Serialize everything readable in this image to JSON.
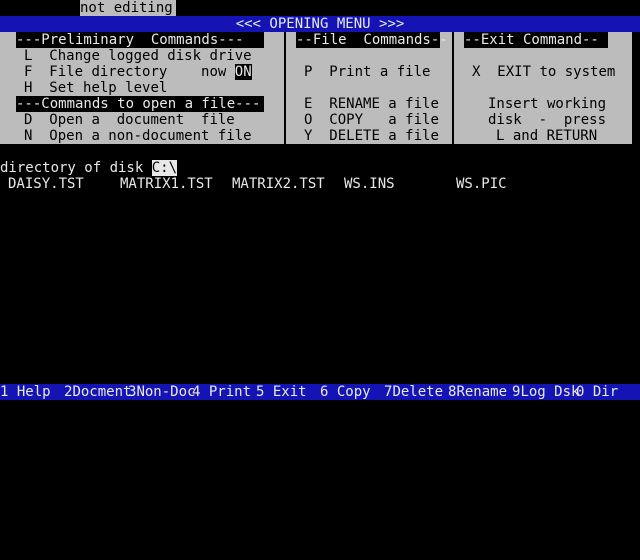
{
  "status": "not editing",
  "title": "<<< OPENING MENU >>>",
  "sections": {
    "preliminary": {
      "header": "---Preliminary  Commands---",
      "items": [
        {
          "key": "L",
          "label": "Change logged disk drive"
        },
        {
          "key": "F",
          "label": "File directory",
          "state_prefix": "now",
          "state": "ON"
        },
        {
          "key": "H",
          "label": "Set help level"
        }
      ]
    },
    "open_file": {
      "header": "---Commands to open a file---",
      "items": [
        {
          "key": "D",
          "label": "Open a  document  file"
        },
        {
          "key": "N",
          "label": "Open a non-document file"
        }
      ]
    },
    "file_commands": {
      "header": "--File  Commands--",
      "items": [
        {
          "key": "P",
          "label": "Print a file"
        },
        {
          "key": "E",
          "label": "RENAME a file"
        },
        {
          "key": "O",
          "label": "COPY   a file"
        },
        {
          "key": "Y",
          "label": "DELETE a file"
        }
      ]
    },
    "exit": {
      "header": "--Exit Command--",
      "items": [
        {
          "key": "X",
          "label": "EXIT to system"
        }
      ],
      "note": [
        "Insert working",
        "disk  -  press",
        "L and RETURN"
      ]
    }
  },
  "directory": {
    "label": "directory of disk",
    "drive": "C:\\",
    "files": [
      "DAISY.TST",
      "MATRIX1.TST",
      "MATRIX2.TST",
      "WS.INS",
      "WS.PIC"
    ]
  },
  "function_keys": [
    {
      "num": "1",
      "label": "Help"
    },
    {
      "num": "2",
      "label": "Docment"
    },
    {
      "num": "3",
      "label": "Non-Doc"
    },
    {
      "num": "4",
      "label": "Print"
    },
    {
      "num": "5",
      "label": "Exit"
    },
    {
      "num": "6",
      "label": "Copy"
    },
    {
      "num": "7",
      "label": "Delete"
    },
    {
      "num": "8",
      "label": "Rename"
    },
    {
      "num": "9",
      "label": "Log Dsk"
    },
    {
      "num": "0",
      "label": "Dir"
    }
  ],
  "colors": {
    "title_bar": "#1414b4",
    "menu_panel": "#bcbcbc",
    "screen": "#000000"
  }
}
